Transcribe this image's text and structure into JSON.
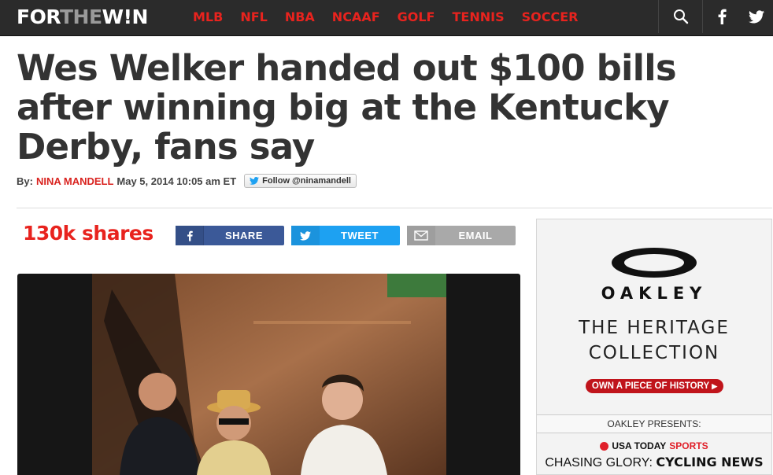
{
  "site": {
    "logo_part1": "FOR",
    "logo_part2": "THE",
    "logo_part3": "W!N"
  },
  "nav": {
    "items": [
      "MLB",
      "NFL",
      "NBA",
      "NCAAF",
      "GOLF",
      "TENNIS",
      "SOCCER"
    ],
    "icons": [
      "search-icon",
      "facebook-icon",
      "twitter-icon"
    ]
  },
  "article": {
    "headline": "Wes Welker handed out $100 bills after winning big at the Kentucky Derby, fans say",
    "by_label": "By:",
    "author": "NINA MANDELL",
    "date": "May 5, 2014 10:05 am ET",
    "follow_label": "Follow @ninamandell"
  },
  "share_bar": {
    "count": "130k shares",
    "share_label": "SHARE",
    "tweet_label": "TWEET",
    "email_label": "EMAIL"
  },
  "ad": {
    "brand": "OAKLEY",
    "heritage_line1": "THE HERITAGE",
    "heritage_line2": "COLLECTION",
    "cta": "OWN A PIECE OF HISTORY",
    "presents": "OAKLEY PRESENTS:",
    "usat_prefix": "USA TODAY",
    "usat_sports": "SPORTS",
    "chasing_prefix": "CHASING GLORY:",
    "chasing_bold": "CYCLING NEWS"
  },
  "colors": {
    "brand_red": "#e8231e",
    "nav_bg": "#2b2b2b",
    "facebook": "#3b5998",
    "twitter": "#1da1f2",
    "email": "#a9a9a9"
  }
}
